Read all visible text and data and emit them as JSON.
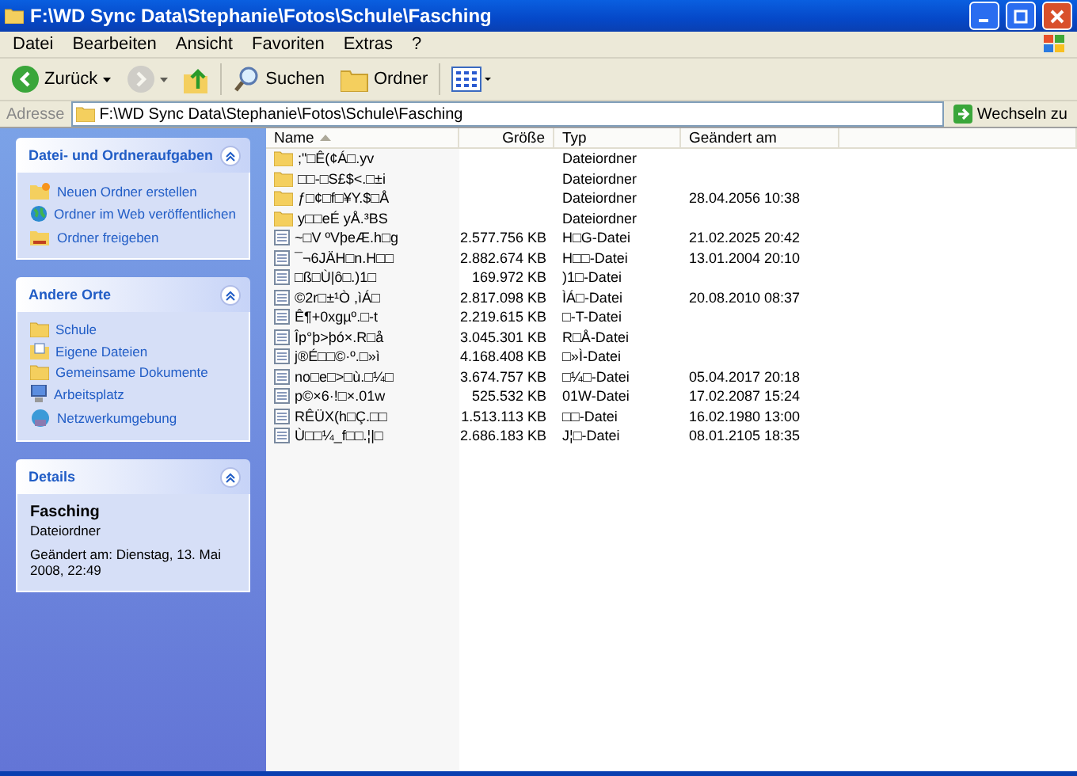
{
  "window": {
    "title": "F:\\WD Sync Data\\Stephanie\\Fotos\\Schule\\Fasching"
  },
  "menu": [
    "Datei",
    "Bearbeiten",
    "Ansicht",
    "Favoriten",
    "Extras",
    "?"
  ],
  "toolbar": [
    {
      "kind": "back",
      "label": "Zurück",
      "disabled": false
    },
    {
      "kind": "forward",
      "disabled": true
    },
    {
      "kind": "up",
      "disabled": false
    },
    {
      "kind": "search",
      "label": "Suchen",
      "disabled": false
    },
    {
      "kind": "folders",
      "label": "Ordner",
      "disabled": false
    },
    {
      "kind": "views",
      "disabled": false
    }
  ],
  "address": {
    "label": "Adresse",
    "value": "F:\\WD Sync Data\\Stephanie\\Fotos\\Schule\\Fasching",
    "go": "Wechseln zu"
  },
  "sidebar": [
    {
      "title": "Datei- und Ordneraufgaben",
      "expanded": true,
      "items": [
        {
          "kind": "new-folder",
          "label": "Neuen Ordner erstellen"
        },
        {
          "kind": "globe",
          "label": "Ordner im Web veröffentlichen"
        },
        {
          "kind": "share",
          "label": "Ordner freigeben"
        }
      ]
    },
    {
      "title": "Andere Orte",
      "expanded": true,
      "items": [
        {
          "kind": "folder",
          "label": "Schule"
        },
        {
          "kind": "documents",
          "label": "Eigene Dateien"
        },
        {
          "kind": "folder",
          "label": "Gemeinsame Dokumente"
        },
        {
          "kind": "computer",
          "label": "Arbeitsplatz"
        },
        {
          "kind": "network",
          "label": "Netzwerkumgebung"
        }
      ]
    }
  ],
  "details": {
    "title": "Details",
    "expanded": true,
    "name": "Fasching",
    "type": "Dateiordner",
    "modified": "Geändert am: Dienstag, 13. Mai 2008, 22:49"
  },
  "columns": [
    {
      "label": "Name",
      "sorted": true
    },
    {
      "label": "Größe",
      "sorted": false
    },
    {
      "label": "Typ",
      "sorted": false
    },
    {
      "label": "Geändert am",
      "sorted": false
    }
  ],
  "rows": [
    {
      "kind": "folder",
      "name": ";\"□Ê(¢Á□.yv",
      "type": "Dateiordner"
    },
    {
      "kind": "folder",
      "name": "□□-□S£$<.□±i",
      "type": "Dateiordner"
    },
    {
      "kind": "folder",
      "name": "ƒ□¢□f□¥Y.$□Å",
      "type": "Dateiordner",
      "modified": "28.04.2056 10:38"
    },
    {
      "kind": "folder",
      "name": "y□□eÉ yÅ.³BS",
      "type": "Dateiordner"
    },
    {
      "kind": "file",
      "name": "~□V ºVþeÆ.h□g",
      "size": "2.577.756 KB",
      "type": "H□G-Datei",
      "modified": "21.02.2025 20:42"
    },
    {
      "kind": "file",
      "name": "¯¬6JÄH□n.H□□",
      "size": "2.882.674 KB",
      "type": "H□□-Datei",
      "modified": "13.01.2004 20:10"
    },
    {
      "kind": "file",
      "name": "□ß□Ù|ô□.)1□",
      "size": "169.972 KB",
      "type": ")1□-Datei"
    },
    {
      "kind": "file",
      "name": "©2r□±¹Ò ,ìÁ□",
      "size": "2.817.098 KB",
      "type": "ÌÁ□-Datei",
      "modified": "20.08.2010 08:37"
    },
    {
      "kind": "file",
      "name": "Ê¶+0xgµº.□-t",
      "size": "2.219.615 KB",
      "type": "□-T-Datei"
    },
    {
      "kind": "file",
      "name": "Îp°þ>þó×.R□å",
      "size": "3.045.301 KB",
      "type": "R□Å-Datei"
    },
    {
      "kind": "file",
      "name": "j®É□□©·º.□»ì",
      "size": "4.168.408 KB",
      "type": "□»Ì-Datei"
    },
    {
      "kind": "file",
      "name": "no□e□>□ù.□¼□",
      "size": "3.674.757 KB",
      "type": "□¼□-Datei",
      "modified": "05.04.2017 20:18"
    },
    {
      "kind": "file",
      "name": "p©×6·!□×.01w",
      "size": "525.532 KB",
      "type": "01W-Datei",
      "modified": "17.02.2087 15:24"
    },
    {
      "kind": "file",
      "name": "RÊÜX(h□Ç.□□",
      "size": "1.513.113 KB",
      "type": "□□-Datei",
      "modified": "16.02.1980 13:00"
    },
    {
      "kind": "file",
      "name": "Ù□□¼_f□□.¦|□",
      "size": "2.686.183 KB",
      "type": "J¦□-Datei",
      "modified": "08.01.2105 18:35"
    }
  ]
}
